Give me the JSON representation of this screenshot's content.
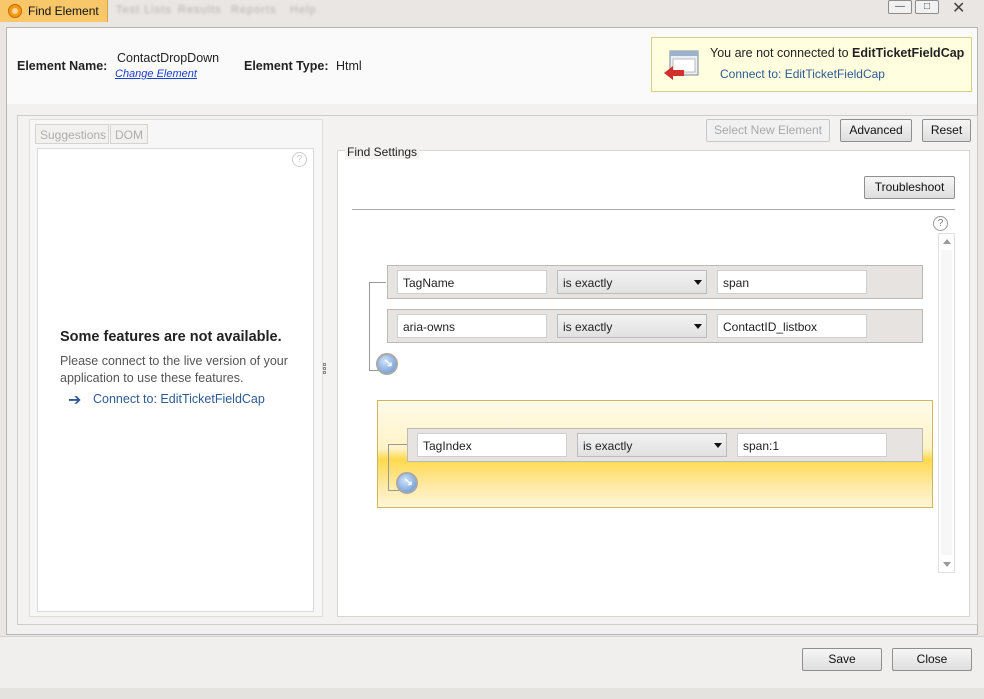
{
  "window": {
    "title": "Find Element",
    "menu_blur": [
      "Test Lists",
      "Results",
      "Reports",
      "Help"
    ],
    "controls": {
      "minimize": "—",
      "maximize": "□",
      "close": "✕"
    }
  },
  "element": {
    "name_label": "Element Name:",
    "name_value": "ContactDropDown",
    "change_link": "Change Element",
    "type_label": "Element Type:",
    "type_value": "Html"
  },
  "notification": {
    "text_prefix": "You are not connected to ",
    "app_name": "EditTicketFieldCap",
    "connect_link": "Connect to: EditTicketFieldCap"
  },
  "left_panel": {
    "tabs": [
      "Suggestions",
      "DOM"
    ],
    "help": "?",
    "title": "Some features are not available.",
    "description": "Please connect to the live version of your application to use these features.",
    "connect_link": "Connect to: EditTicketFieldCap"
  },
  "toolbar": {
    "select_new": "Select New Element",
    "advanced": "Advanced",
    "reset": "Reset"
  },
  "find_settings": {
    "label": "Find Settings",
    "troubleshoot": "Troubleshoot",
    "help": "?",
    "rules": [
      {
        "attribute": "TagName",
        "operator": "is exactly",
        "value": "span"
      },
      {
        "attribute": "aria-owns",
        "operator": "is exactly",
        "value": "ContactID_listbox"
      }
    ],
    "group_rules": [
      {
        "attribute": "TagIndex",
        "operator": "is exactly",
        "value": "span:1"
      }
    ]
  },
  "footer": {
    "save": "Save",
    "close": "Close"
  },
  "colors": {
    "accent_link": "#2e5a93",
    "notify_bg": "#ffffe0",
    "group_highlight": "#ffd94d"
  },
  "icons": [
    "app-icon",
    "back-arrow-icon",
    "question-icon",
    "right-arrow-icon",
    "add-rule-icon",
    "dropdown-arrow-icon",
    "scroll-up-icon",
    "scroll-down-icon",
    "grip-icon"
  ]
}
